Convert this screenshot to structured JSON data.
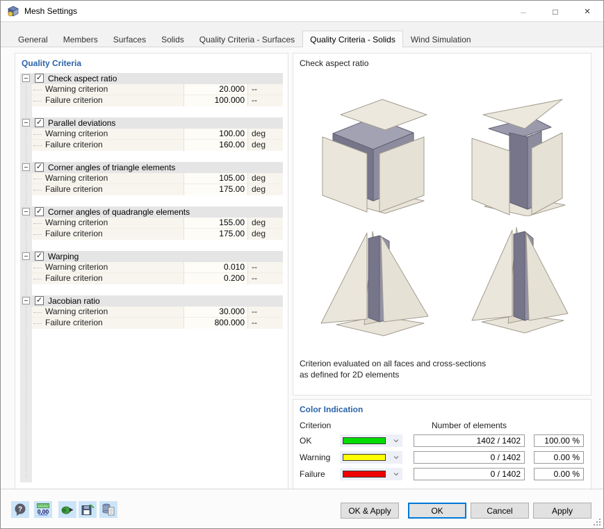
{
  "titlebar": {
    "title": "Mesh Settings"
  },
  "window_controls": {
    "minimize": "–",
    "maximize": "□",
    "close": "×"
  },
  "tabs": {
    "items": [
      "General",
      "Members",
      "Surfaces",
      "Solids",
      "Quality Criteria - Surfaces",
      "Quality Criteria - Solids",
      "Wind Simulation"
    ],
    "active": "Quality Criteria - Solids"
  },
  "quality_criteria": {
    "heading": "Quality Criteria",
    "check_glyph": "✓",
    "warning_label": "Warning criterion",
    "failure_label": "Failure criterion",
    "groups": [
      {
        "label": "Check aspect ratio",
        "checked": true,
        "warning_value": "20.000",
        "warning_unit": "--",
        "failure_value": "100.000",
        "failure_unit": "--"
      },
      {
        "label": "Parallel deviations",
        "checked": true,
        "warning_value": "100.00",
        "warning_unit": "deg",
        "failure_value": "160.00",
        "failure_unit": "deg"
      },
      {
        "label": "Corner angles of triangle elements",
        "checked": true,
        "warning_value": "105.00",
        "warning_unit": "deg",
        "failure_value": "175.00",
        "failure_unit": "deg"
      },
      {
        "label": "Corner angles of quadrangle elements",
        "checked": true,
        "warning_value": "155.00",
        "warning_unit": "deg",
        "failure_value": "175.00",
        "failure_unit": "deg"
      },
      {
        "label": "Warping",
        "checked": true,
        "warning_value": "0.010",
        "warning_unit": "--",
        "failure_value": "0.200",
        "failure_unit": "--"
      },
      {
        "label": "Jacobian ratio",
        "checked": true,
        "warning_value": "30.000",
        "warning_unit": "--",
        "failure_value": "800.000",
        "failure_unit": "--"
      }
    ]
  },
  "preview": {
    "title": "Check aspect ratio",
    "caption_line1": "Criterion evaluated on all faces and cross-sections",
    "caption_line2": "as defined for 2D elements"
  },
  "color_indication": {
    "heading": "Color Indication",
    "criterion_label": "Criterion",
    "number_of_elements_label": "Number of elements",
    "rows": [
      {
        "label": "OK",
        "color": "#00dd00",
        "count": "1402 / 1402",
        "percent": "100.00 %"
      },
      {
        "label": "Warning",
        "color": "#ffff00",
        "count": "0 / 1402",
        "percent": "0.00 %"
      },
      {
        "label": "Failure",
        "color": "#ee0000",
        "count": "0 / 1402",
        "percent": "0.00 %"
      }
    ]
  },
  "buttons": {
    "ok_apply": "OK & Apply",
    "ok": "OK",
    "cancel": "Cancel",
    "apply": "Apply"
  },
  "toolbar": {
    "help_glyph": "?",
    "decimal_label": "0,00"
  }
}
